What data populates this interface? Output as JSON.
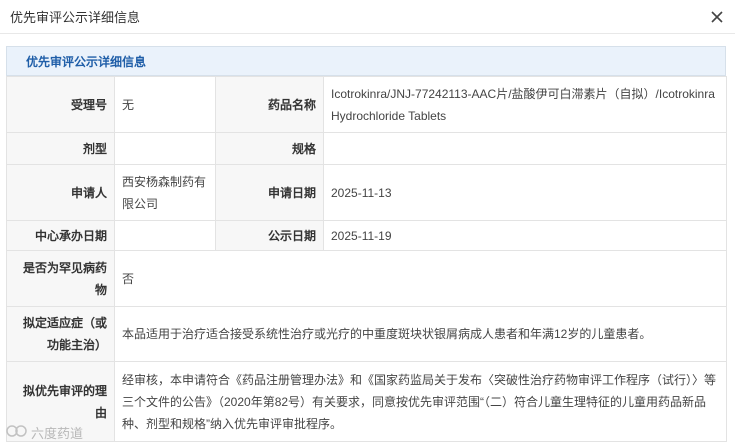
{
  "dialog": {
    "title": "优先审评公示详细信息",
    "close_icon": "close-icon"
  },
  "section": {
    "title": "优先审评公示详细信息"
  },
  "fields": {
    "acceptance_no_label": "受理号",
    "acceptance_no_value": "无",
    "drug_name_label": "药品名称",
    "drug_name_value": "Icotrokinra/JNJ-77242113-AAC片/盐酸伊可白滞素片（自拟）/Icotrokinra Hydrochloride Tablets",
    "dosage_form_label": "剂型",
    "dosage_form_value": "",
    "spec_label": "规格",
    "spec_value": "",
    "applicant_label": "申请人",
    "applicant_value": "西安杨森制药有限公司",
    "apply_date_label": "申请日期",
    "apply_date_value": "2025-11-13",
    "center_date_label": "中心承办日期",
    "center_date_value": "",
    "publicity_date_label": "公示日期",
    "publicity_date_value": "2025-11-19",
    "rare_disease_label": "是否为罕见病药物",
    "rare_disease_value": "否",
    "indication_label": "拟定适应症（或功能主治）",
    "indication_value": "本品适用于治疗适合接受系统性治疗或光疗的中重度斑块状银屑病成人患者和年满12岁的儿童患者。",
    "reason_label": "拟优先审评的理由",
    "reason_value": "经审核，本申请符合《药品注册管理办法》和《国家药监局关于发布〈突破性治疗药物审评工作程序（试行）〉等三个文件的公告》（2020年第82号）有关要求，同意按优先审评范围“（二）符合儿童生理特征的儿童用药品新品种、剂型和规格”纳入优先审评审批程序。"
  },
  "watermark": {
    "text": "六度药道",
    "logo_icon": "logo-icon"
  },
  "colors": {
    "header_bg": "#eaf2fb",
    "header_text": "#1f5ea8",
    "label_bg": "#f7f7f7",
    "border": "#e3e3e3"
  }
}
